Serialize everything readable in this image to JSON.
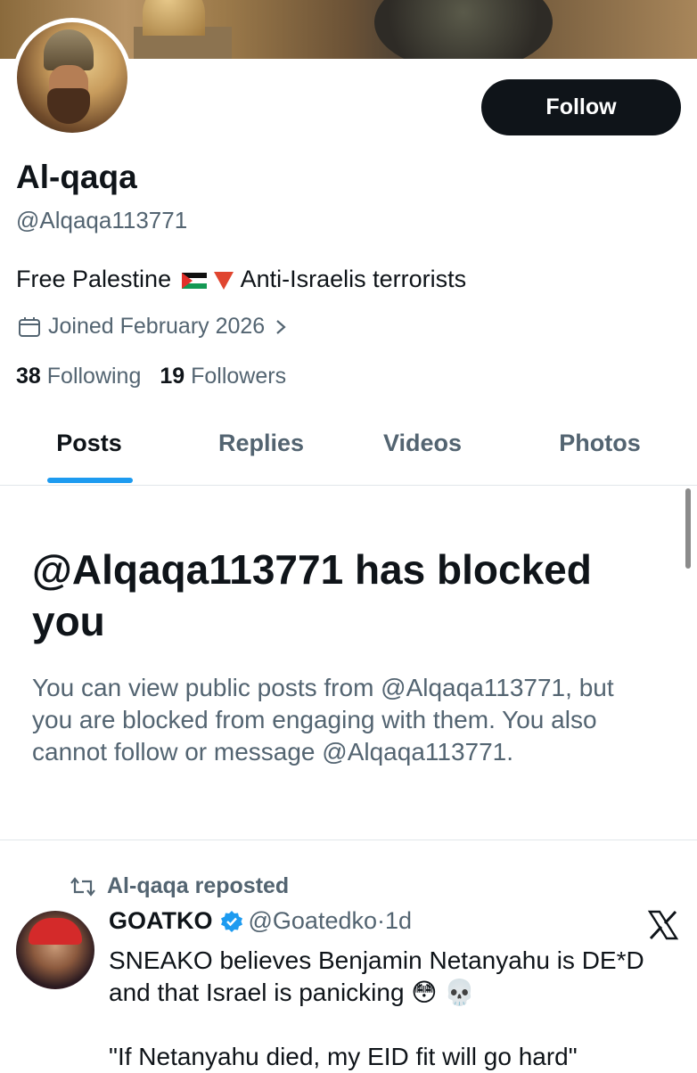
{
  "profile": {
    "name": "Al-qaqa",
    "handle": "@Alqaqa113771",
    "bio_part1": "Free Palestine",
    "bio_part2": "Anti-Israelis terrorists",
    "joined": "Joined February 2026",
    "following_count": "38",
    "following_label": "Following",
    "followers_count": "19",
    "followers_label": "Followers"
  },
  "follow_button": {
    "label": "Follow"
  },
  "tabs": [
    {
      "label": "Posts",
      "active": true
    },
    {
      "label": "Replies",
      "active": false
    },
    {
      "label": "Videos",
      "active": false
    },
    {
      "label": "Photos",
      "active": false
    }
  ],
  "blocked": {
    "title": "@Alqaqa113771 has blocked you",
    "description": "You can view public posts from @Alqaqa113771, but you are blocked from engaging with them. You also cannot follow or message @Alqaqa113771."
  },
  "post": {
    "repost_label": "Al-qaqa reposted",
    "author_name": "GOATKO",
    "author_handle": "@Goatedko",
    "separator": "·",
    "time": "1d",
    "text": "SNEAKO believes  Benjamin Netanyahu is DE*D\nand that Israel is panicking 😳 💀\n\n\"If Netanyahu died, my EID fit will go hard\""
  },
  "colors": {
    "text_primary": "#0f1419",
    "text_secondary": "#536471",
    "accent": "#1d9bf0",
    "button_bg": "#0f1419"
  },
  "icons": {
    "calendar": "calendar-icon",
    "chevron": "chevron-right-icon",
    "repost": "repost-icon",
    "verified": "verified-badge-icon",
    "x_logo": "x-logo-icon"
  }
}
